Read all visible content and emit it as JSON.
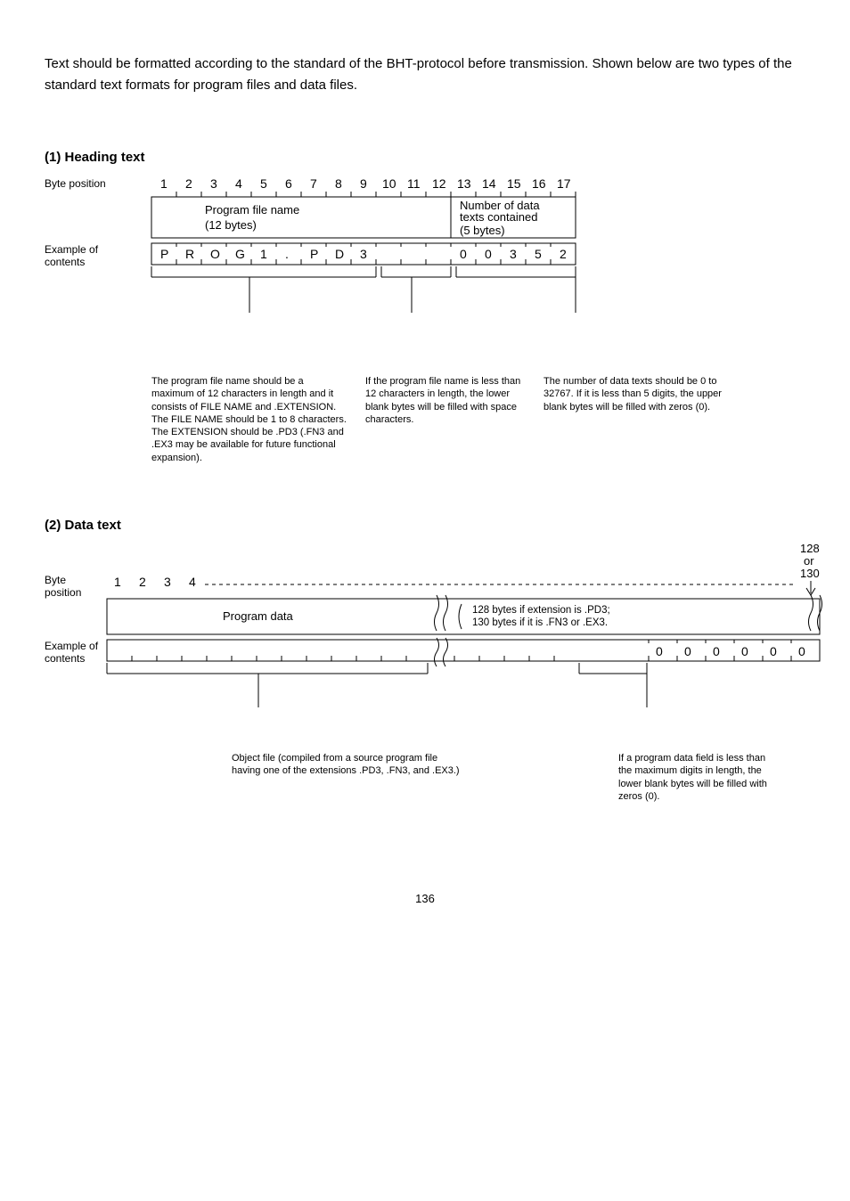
{
  "intro": "Text should be formatted according to the standard of the BHT-protocol before transmission.  Shown below are two types of the standard text formats for program files and data files.",
  "section1_heading": "(1)  Heading text",
  "heading_diagram": {
    "byte_position_label": "Byte position",
    "example_label_line1": "Example of",
    "example_label_line2": "contents",
    "byte_numbers": [
      "1",
      "2",
      "3",
      "4",
      "5",
      "6",
      "7",
      "8",
      "9",
      "10",
      "11",
      "12",
      "13",
      "14",
      "15",
      "16",
      "17"
    ],
    "field1_label_line1": "Program file name",
    "field1_label_line2": "(12 bytes)",
    "field2_label_line1": "Number of data",
    "field2_label_line2": "texts contained",
    "field2_label_line3": "(5 bytes)",
    "example_cells": [
      "P",
      "R",
      "O",
      "G",
      "1",
      ".",
      "P",
      "D",
      "3",
      "",
      "",
      "",
      "0",
      "0",
      "3",
      "5",
      "2"
    ],
    "note1": "The program file name should be a maximum of 12 characters in length and it consists of FILE NAME and .EXTENSION.  The FILE NAME should be 1 to 8 characters.  The EXTENSION should be .PD3 (.FN3 and .EX3 may be available for future functional expansion).",
    "note2": "If the program file name is less than 12 characters in length, the lower blank bytes will be filled with space characters.",
    "note3": "The number of data texts should be 0 to 32767.  If it is less than 5 digits, the upper blank bytes will be filled with zeros (0)."
  },
  "section2_heading": "(2)  Data text",
  "data_diagram": {
    "byte_position_label_line1": "Byte",
    "byte_position_label_line2": "position",
    "example_label_line1": "Example of",
    "example_label_line2": "contents",
    "leading_numbers": [
      "1",
      "2",
      "3",
      "4"
    ],
    "right_label_line1": "128",
    "right_label_line2": "or",
    "right_label_line3": "130",
    "field_label": "Program data",
    "right_note_line1": "128 bytes if extension is .PD3;",
    "right_note_line2": "130 bytes if it is .FN3 or .EX3.",
    "example_trailing": [
      "0",
      "0",
      "0",
      "0",
      "0",
      "0"
    ],
    "note_left": "Object file (compiled from a source program file having one of the extensions .PD3, .FN3, and .EX3.)",
    "note_right": "If a program data field is less than the maximum digits in length, the lower blank bytes will be filled with zeros (0)."
  },
  "page_number": "136"
}
